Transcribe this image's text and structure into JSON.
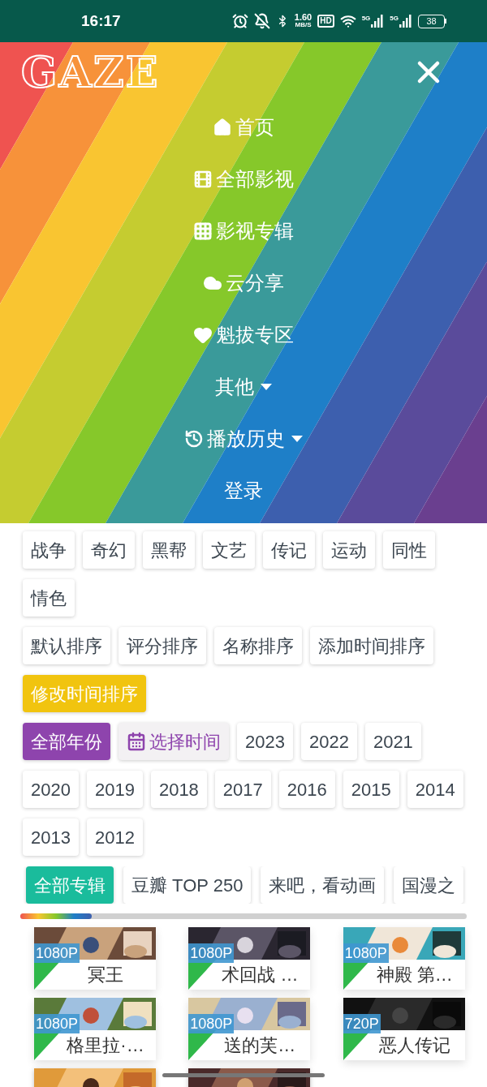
{
  "status_bar": {
    "time": "16:17",
    "speed_value": "1.60",
    "speed_unit": "MB/S",
    "hd": "HD",
    "network_1": "5G",
    "network_2": "5G",
    "battery": "38"
  },
  "menu": {
    "logo": "GAZE",
    "items": [
      {
        "label": "首页",
        "kind": "home",
        "dropdown": false
      },
      {
        "label": "全部影视",
        "kind": "film",
        "dropdown": false
      },
      {
        "label": "影视专辑",
        "kind": "grid",
        "dropdown": false
      },
      {
        "label": "云分享",
        "kind": "cloud",
        "dropdown": false
      },
      {
        "label": "魁拔专区",
        "kind": "heart",
        "dropdown": false
      },
      {
        "label": "其他",
        "kind": "plain",
        "dropdown": true
      },
      {
        "label": "播放历史",
        "kind": "history",
        "dropdown": true
      },
      {
        "label": "登录",
        "kind": "plain",
        "dropdown": false
      }
    ]
  },
  "filter_groups": [
    {
      "kind": "genre",
      "tags": [
        {
          "label": "战争",
          "selected": false
        },
        {
          "label": "奇幻",
          "selected": false
        },
        {
          "label": "黑帮",
          "selected": false
        },
        {
          "label": "文艺",
          "selected": false
        },
        {
          "label": "传记",
          "selected": false
        },
        {
          "label": "运动",
          "selected": false
        },
        {
          "label": "同性",
          "selected": false
        },
        {
          "label": "情色",
          "selected": false
        }
      ]
    },
    {
      "kind": "sort",
      "tags": [
        {
          "label": "默认排序",
          "selected": false
        },
        {
          "label": "评分排序",
          "selected": false
        },
        {
          "label": "名称排序",
          "selected": false
        },
        {
          "label": "添加时间排序",
          "selected": false
        },
        {
          "label": "修改时间排序",
          "selected": true
        }
      ]
    },
    {
      "kind": "year",
      "tags": [
        {
          "label": "全部年份",
          "selected": true
        },
        {
          "label": "选择时间",
          "selected": false,
          "kind": "date-picker"
        },
        {
          "label": "2023",
          "selected": false
        },
        {
          "label": "2022",
          "selected": false
        },
        {
          "label": "2021",
          "selected": false
        },
        {
          "label": "2020",
          "selected": false
        },
        {
          "label": "2019",
          "selected": false
        },
        {
          "label": "2018",
          "selected": false
        },
        {
          "label": "2017",
          "selected": false
        },
        {
          "label": "2016",
          "selected": false
        },
        {
          "label": "2015",
          "selected": false
        },
        {
          "label": "2014",
          "selected": false
        },
        {
          "label": "2013",
          "selected": false
        },
        {
          "label": "2012",
          "selected": false
        }
      ]
    },
    {
      "kind": "album",
      "tags": [
        {
          "label": "全部专辑",
          "selected": true
        },
        {
          "label": "豆瓣 TOP 250",
          "selected": false
        },
        {
          "label": "来吧，看动画",
          "selected": false
        },
        {
          "label": "国漫之",
          "selected": false
        }
      ]
    }
  ],
  "movies": [
    {
      "title": "冥王",
      "quality": "1080P"
    },
    {
      "title": "术回战 …",
      "quality": "1080P"
    },
    {
      "title": "神殿 第…",
      "quality": "1080P"
    },
    {
      "title": "格里拉·…",
      "quality": "1080P"
    },
    {
      "title": "送的芙…",
      "quality": "1080P"
    },
    {
      "title": "恶人传记",
      "quality": "720P"
    },
    {
      "kind": "picture"
    },
    {
      "kind": "picture"
    }
  ]
}
